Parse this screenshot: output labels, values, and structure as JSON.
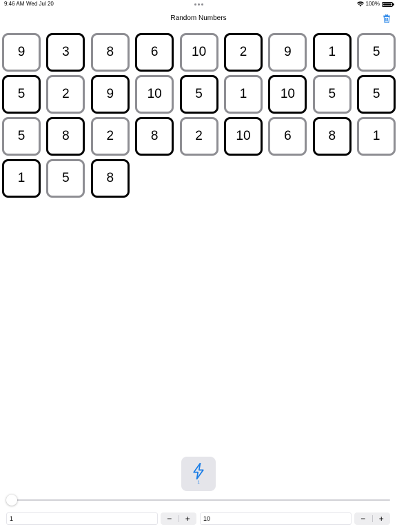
{
  "status_bar": {
    "time": "9:46 AM",
    "date": "Wed Jul 20",
    "battery_text": "100%",
    "battery_level": 1.0
  },
  "nav": {
    "title": "Random Numbers",
    "trash_icon": "trash-icon"
  },
  "tiles": [
    {
      "value": "9",
      "style": "light"
    },
    {
      "value": "3",
      "style": "dark"
    },
    {
      "value": "8",
      "style": "light"
    },
    {
      "value": "6",
      "style": "dark"
    },
    {
      "value": "10",
      "style": "light"
    },
    {
      "value": "2",
      "style": "dark"
    },
    {
      "value": "9",
      "style": "light"
    },
    {
      "value": "1",
      "style": "dark"
    },
    {
      "value": "5",
      "style": "light"
    },
    {
      "value": "5",
      "style": "dark"
    },
    {
      "value": "2",
      "style": "light"
    },
    {
      "value": "9",
      "style": "dark"
    },
    {
      "value": "10",
      "style": "light"
    },
    {
      "value": "5",
      "style": "dark"
    },
    {
      "value": "1",
      "style": "light"
    },
    {
      "value": "10",
      "style": "dark"
    },
    {
      "value": "5",
      "style": "light"
    },
    {
      "value": "5",
      "style": "dark"
    },
    {
      "value": "5",
      "style": "light"
    },
    {
      "value": "8",
      "style": "dark"
    },
    {
      "value": "2",
      "style": "light"
    },
    {
      "value": "8",
      "style": "dark"
    },
    {
      "value": "2",
      "style": "light"
    },
    {
      "value": "10",
      "style": "dark"
    },
    {
      "value": "6",
      "style": "light"
    },
    {
      "value": "8",
      "style": "dark"
    },
    {
      "value": "1",
      "style": "light"
    },
    {
      "value": "1",
      "style": "dark"
    },
    {
      "value": "5",
      "style": "light"
    },
    {
      "value": "8",
      "style": "dark"
    }
  ],
  "action": {
    "icon": "bolt-icon",
    "count": "1",
    "accent_color": "#1a7de6"
  },
  "slider": {
    "value": 1,
    "min": 1,
    "max": 10
  },
  "range": {
    "min_value": "1",
    "max_value": "10",
    "decrement_symbol": "−",
    "increment_symbol": "+"
  },
  "colors": {
    "dark_border": "#000000",
    "light_border": "#8e8e93",
    "accent": "#1a7de6"
  }
}
